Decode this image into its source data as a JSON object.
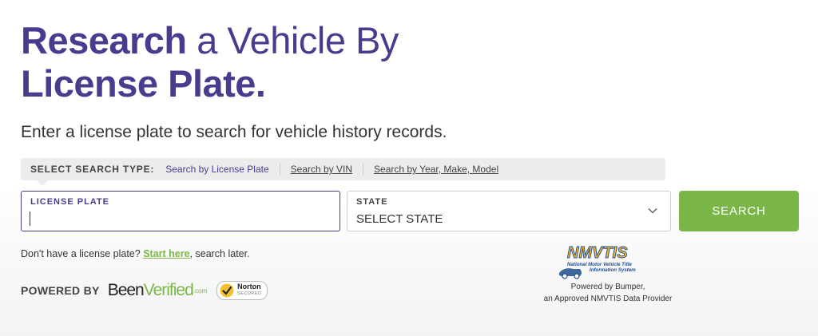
{
  "heading": {
    "line1_bold": "Research",
    "line1_light": " a Vehicle By",
    "line2_bold": "License Plate."
  },
  "subtitle": "Enter a license plate to search for vehicle history records.",
  "search_type": {
    "label": "SELECT SEARCH TYPE:",
    "options": [
      {
        "label": "Search by License Plate",
        "active": true
      },
      {
        "label": "Search by VIN",
        "active": false
      },
      {
        "label": "Search by Year, Make, Model",
        "active": false
      }
    ]
  },
  "license_plate": {
    "label": "LICENSE PLATE",
    "value": "",
    "placeholder": ""
  },
  "state": {
    "label": "STATE",
    "selected": "SELECT STATE"
  },
  "search_button": "SEARCH",
  "hint": {
    "prefix": "Don't have a license plate? ",
    "link": "Start here",
    "suffix": ", search later."
  },
  "powered_by": {
    "label": "POWERED BY",
    "brand_part1": "Been",
    "brand_part2": "Verified",
    "brand_suffix": ".com",
    "norton_name": "Norton",
    "norton_sub": "SECURED"
  },
  "nmvtis": {
    "title": "NMVTIS",
    "subtitle_line1": "National Motor Vehicle Title",
    "subtitle_line2": "Information System",
    "provider_line1": "Powered by Bumper,",
    "provider_line2": "an Approved NMVTIS Data Provider"
  },
  "colors": {
    "brand_purple": "#4b3b8f",
    "accent_green": "#7ab648",
    "nmvtis_gold": "#f2b631",
    "nmvtis_blue": "#1f4e8c"
  }
}
